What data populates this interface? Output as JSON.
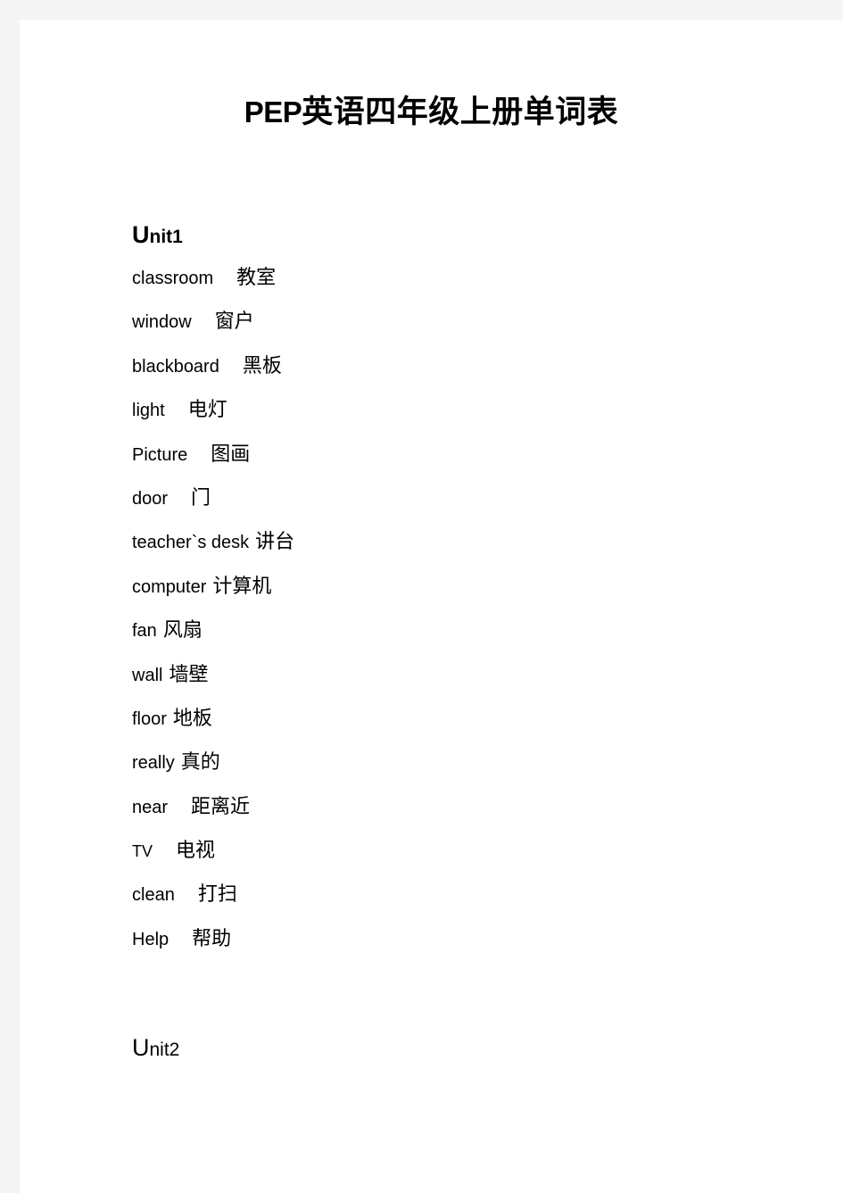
{
  "document": {
    "title_latin": "PEP",
    "title_cjk": "英语四年级上册单词表",
    "title_full": "PEP 英语四年级上册单词表"
  },
  "units": [
    {
      "heading_initial": "U",
      "heading_rest": "nit1",
      "heading_full": "Unit1",
      "bold": true,
      "words": [
        {
          "en": "classroom",
          "cn": "教室",
          "gap": "wide",
          "size": "normal"
        },
        {
          "en": "window",
          "cn": "窗户",
          "gap": "wide",
          "size": "normal"
        },
        {
          "en": "blackboard",
          "cn": "黑板",
          "gap": "wide",
          "size": "normal"
        },
        {
          "en": "light",
          "cn": "电灯",
          "gap": "wide",
          "size": "normal"
        },
        {
          "en": "Picture",
          "cn": "图画",
          "gap": "wide",
          "size": "normal"
        },
        {
          "en": "door",
          "cn": "门",
          "gap": "wide",
          "size": "normal"
        },
        {
          "en": "teacher`s  desk",
          "cn": "讲台",
          "gap": "narrow",
          "size": "normal"
        },
        {
          "en": "computer",
          "cn": "计算机",
          "gap": "narrow",
          "size": "normal"
        },
        {
          "en": "fan",
          "cn": "风扇",
          "gap": "narrow",
          "size": "normal"
        },
        {
          "en": "wall",
          "cn": "墙壁",
          "gap": "narrow",
          "size": "normal"
        },
        {
          "en": "floor",
          "cn": "地板",
          "gap": "narrow",
          "size": "normal"
        },
        {
          "en": "really",
          "cn": "真的",
          "gap": "narrow",
          "size": "normal"
        },
        {
          "en": "near",
          "cn": "距离近",
          "gap": "wide",
          "size": "normal"
        },
        {
          "en": "TV",
          "cn": "电视",
          "gap": "wide",
          "size": "small"
        },
        {
          "en": "clean",
          "cn": "打扫",
          "gap": "wide",
          "size": "normal"
        },
        {
          "en": "Help",
          "cn": "帮助",
          "gap": "wide",
          "size": "normal"
        }
      ]
    },
    {
      "heading_initial": "U",
      "heading_rest": "nit2",
      "heading_full": "Unit2",
      "bold": false,
      "words": []
    }
  ],
  "colors": {
    "page_background": "#ffffff",
    "canvas_background": "#f4f4f4",
    "text": "#000000"
  }
}
